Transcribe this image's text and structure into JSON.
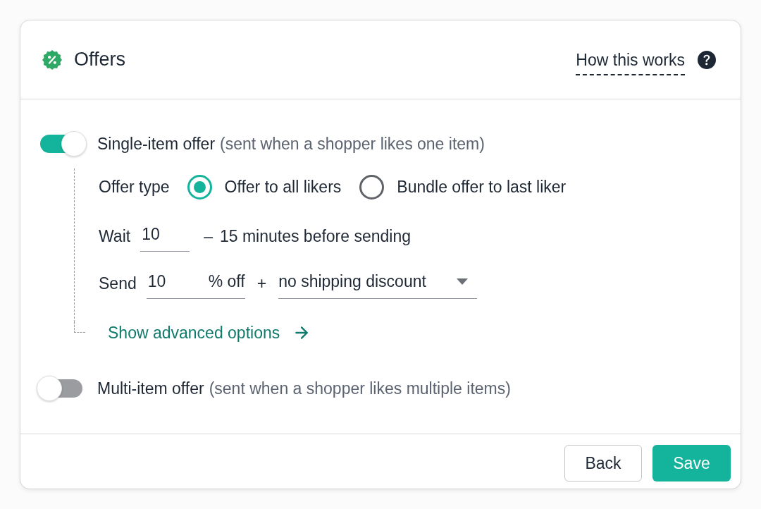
{
  "header": {
    "title": "Offers",
    "help_link": "How this works"
  },
  "offers": [
    {
      "title": "Single-item offer",
      "note": "(sent when a shopper likes one item)",
      "on": true,
      "settings": {
        "offer_type": {
          "label": "Offer type",
          "options": [
            {
              "label": "Offer to all likers",
              "selected": true
            },
            {
              "label": "Bundle offer to last liker",
              "selected": false
            }
          ]
        },
        "wait": {
          "label": "Wait",
          "value": "10",
          "dash": "–",
          "text": "15 minutes before sending"
        },
        "send": {
          "label": "Send",
          "value": "10",
          "unit": "% off",
          "plus": "+",
          "shipping": "no shipping discount"
        },
        "advanced_link": "Show advanced options"
      }
    },
    {
      "title": "Multi-item offer",
      "note": "(sent when a shopper likes multiple items)",
      "on": false
    }
  ],
  "footer": {
    "buttons": [
      {
        "label": "Back",
        "kind": "secondary"
      },
      {
        "label": "Save",
        "kind": "primary"
      }
    ]
  }
}
